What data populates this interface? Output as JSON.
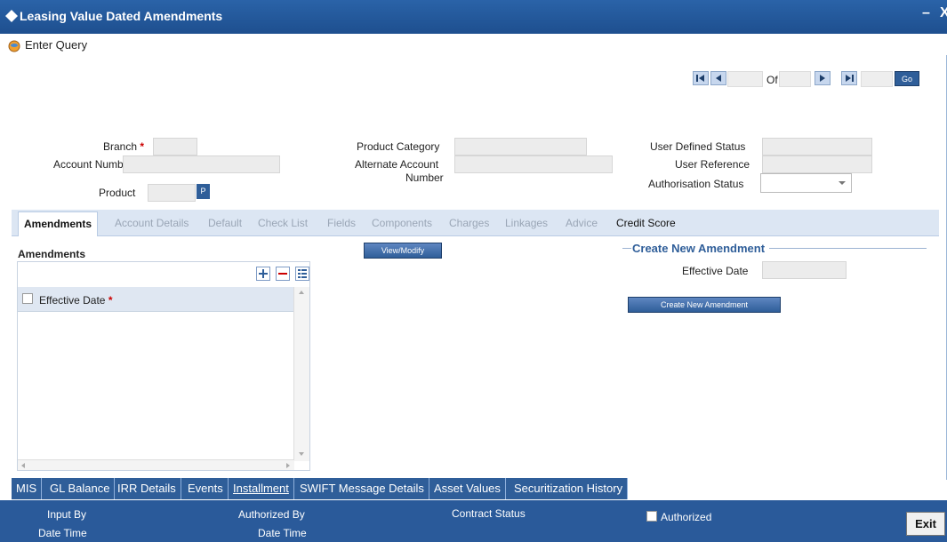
{
  "window": {
    "title": "Leasing Value Dated Amendments",
    "minimize": "–",
    "close": "X"
  },
  "toolbar": {
    "enter_query": "Enter Query"
  },
  "pager": {
    "of_label": "Of",
    "go": "Go"
  },
  "form": {
    "branch": "Branch",
    "account_number": "Account Number",
    "product": "Product",
    "product_btn": "P",
    "product_category": "Product Category",
    "alternate_account_line1": "Alternate Account",
    "alternate_account_line2": "Number",
    "user_defined_status": "User Defined Status",
    "user_reference": "User Reference",
    "authorisation_status": "Authorisation Status",
    "required_mark": "*"
  },
  "tabs": [
    "Amendments",
    "Account Details",
    "Default",
    "Check List",
    "Fields",
    "Components",
    "Charges",
    "Linkages",
    "Advice",
    "Credit Score"
  ],
  "amendments": {
    "section_title": "Amendments",
    "column": "Effective Date",
    "view_modify": "View/Modify"
  },
  "create": {
    "section_title": "Create New Amendment",
    "effective_date": "Effective Date",
    "button": "Create New Amendment"
  },
  "bottom_tabs": [
    "MIS",
    "GL Balance",
    "IRR Details",
    "Events",
    "Installment",
    "SWIFT Message Details",
    "Asset Values",
    "Securitization History"
  ],
  "footer": {
    "input_by": "Input By",
    "date_time_1": "Date Time",
    "authorized_by": "Authorized By",
    "date_time_2": "Date Time",
    "contract_status": "Contract Status",
    "authorized": "Authorized",
    "exit": "Exit"
  },
  "colors": {
    "accent": "#2f5e99",
    "title_bar": "#2a63a8",
    "required": "#cc0000"
  }
}
